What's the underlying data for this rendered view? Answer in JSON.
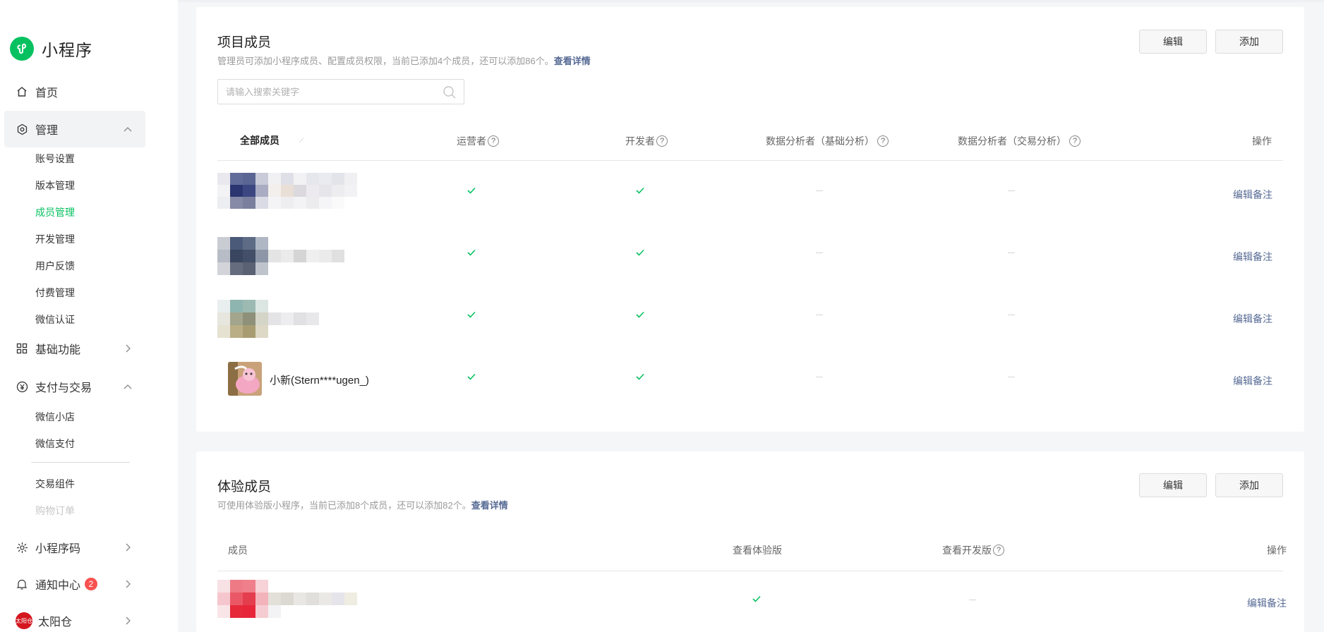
{
  "app": {
    "name": "小程序"
  },
  "sidebar": {
    "home": "首页",
    "manage": {
      "label": "管理",
      "items": [
        "账号设置",
        "版本管理",
        "成员管理",
        "开发管理",
        "用户反馈",
        "付费管理",
        "微信认证"
      ]
    },
    "basic": "基础功能",
    "payment": {
      "label": "支付与交易",
      "items": [
        "微信小店",
        "微信支付",
        "交易组件",
        "购物订单"
      ]
    },
    "qrcode": "小程序码",
    "notify": {
      "label": "通知中心",
      "count": "2"
    },
    "account": {
      "label": "太阳仓",
      "avatar_text": "太阳仓"
    }
  },
  "project_members": {
    "title": "项目成员",
    "desc": "管理员可添加小程序成员、配置成员权限，当前已添加4个成员，还可以添加86个。",
    "detail_link": "查看详情",
    "edit_button": "编辑",
    "add_button": "添加",
    "search_placeholder": "请输入搜索关键字",
    "columns": {
      "all": "全部成员",
      "operator": "运营者",
      "developer": "开发者",
      "analyst_basic": "数据分析者（基础分析）",
      "analyst_trade": "数据分析者（交易分析）",
      "action": "操作"
    },
    "help_symbol": "?",
    "rows": [
      {
        "name": "",
        "operator": true,
        "developer": true,
        "action": "编辑备注"
      },
      {
        "name": "",
        "operator": true,
        "developer": true,
        "action": "编辑备注"
      },
      {
        "name": "",
        "operator": true,
        "developer": true,
        "action": "编辑备注"
      },
      {
        "name": "小新(Stern****ugen_)",
        "operator": true,
        "developer": true,
        "action": "编辑备注"
      }
    ]
  },
  "trial_members": {
    "title": "体验成员",
    "desc": "可使用体验版小程序，当前已添加8个成员，还可以添加82个。",
    "detail_link": "查看详情",
    "edit_button": "编辑",
    "add_button": "添加",
    "columns": {
      "member": "成员",
      "view_trial": "查看体验版",
      "view_dev": "查看开发版",
      "action": "操作"
    },
    "rows": [
      {
        "name": "",
        "view_trial": true,
        "view_dev": false,
        "action": "编辑备注"
      }
    ]
  },
  "colors": {
    "brand_green": "#07c160",
    "link_blue": "#576b95",
    "badge_red": "#fa5151"
  }
}
